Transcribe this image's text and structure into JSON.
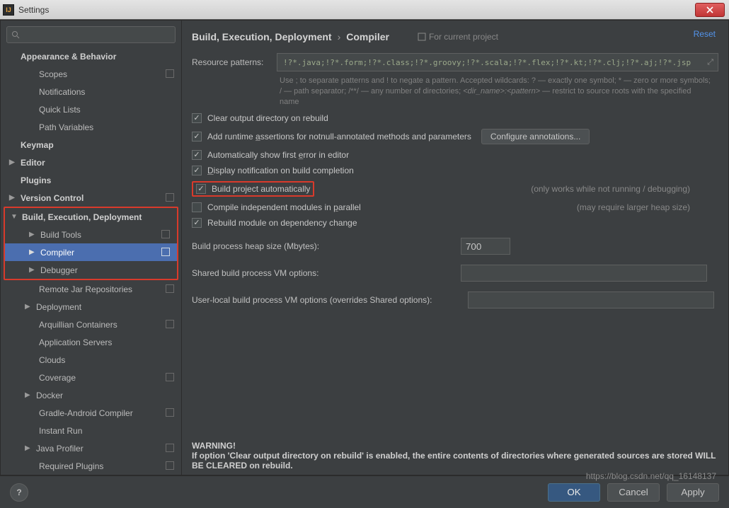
{
  "window": {
    "title": "Settings"
  },
  "search": {
    "placeholder": ""
  },
  "sidebar": {
    "appearance": "Appearance & Behavior",
    "scopes": "Scopes",
    "notifications": "Notifications",
    "quicklists": "Quick Lists",
    "pathvars": "Path Variables",
    "keymap": "Keymap",
    "editor": "Editor",
    "plugins": "Plugins",
    "vcs": "Version Control",
    "bed": "Build, Execution, Deployment",
    "buildtools": "Build Tools",
    "compiler": "Compiler",
    "debugger": "Debugger",
    "remotejar": "Remote Jar Repositories",
    "deployment": "Deployment",
    "arquillian": "Arquillian Containers",
    "appservers": "Application Servers",
    "clouds": "Clouds",
    "coverage": "Coverage",
    "docker": "Docker",
    "gradleandroid": "Gradle-Android Compiler",
    "instantrun": "Instant Run",
    "javaprofiler": "Java Profiler",
    "requiredplugins": "Required Plugins"
  },
  "crumb": {
    "root": "Build, Execution, Deployment",
    "leaf": "Compiler",
    "scope": "For current project",
    "reset": "Reset"
  },
  "patterns": {
    "label": "Resource patterns:",
    "value": "!?*.java;!?*.form;!?*.class;!?*.groovy;!?*.scala;!?*.flex;!?*.kt;!?*.clj;!?*.aj;!?*.jsp",
    "hint1": "Use ; to separate patterns and ! to negate a pattern. Accepted wildcards: ? — exactly one symbol; * — zero or more symbols; / — path separator; /**/ — any number of directories;",
    "hint2": "<dir_name>:<pattern>",
    "hint3": " — restrict to source roots with the specified name"
  },
  "checks": {
    "clear": "Clear output directory on rebuild",
    "runtime": "Add runtime assertions for notnull-annotated methods and parameters",
    "configure": "Configure annotations...",
    "autoerr": "Automatically show first error in editor",
    "notify": "Display notification on build completion",
    "autobuild": "Build project automatically",
    "autobuild_note": "(only works while not running / debugging)",
    "parallel": "Compile independent modules in parallel",
    "parallel_note": "(may require larger heap size)",
    "rebuilddep": "Rebuild module on dependency change"
  },
  "fields": {
    "heap_label": "Build process heap size (Mbytes):",
    "heap_value": "700",
    "shared_label": "Shared build process VM options:",
    "local_label": "User-local build process VM options (overrides Shared options):"
  },
  "warning": {
    "head": "WARNING!",
    "body": "If option 'Clear output directory on rebuild' is enabled, the entire contents of directories where generated sources are stored WILL BE CLEARED on rebuild."
  },
  "buttons": {
    "ok": "OK",
    "cancel": "Cancel",
    "apply": "Apply"
  },
  "watermark": "https://blog.csdn.net/qq_16148137"
}
